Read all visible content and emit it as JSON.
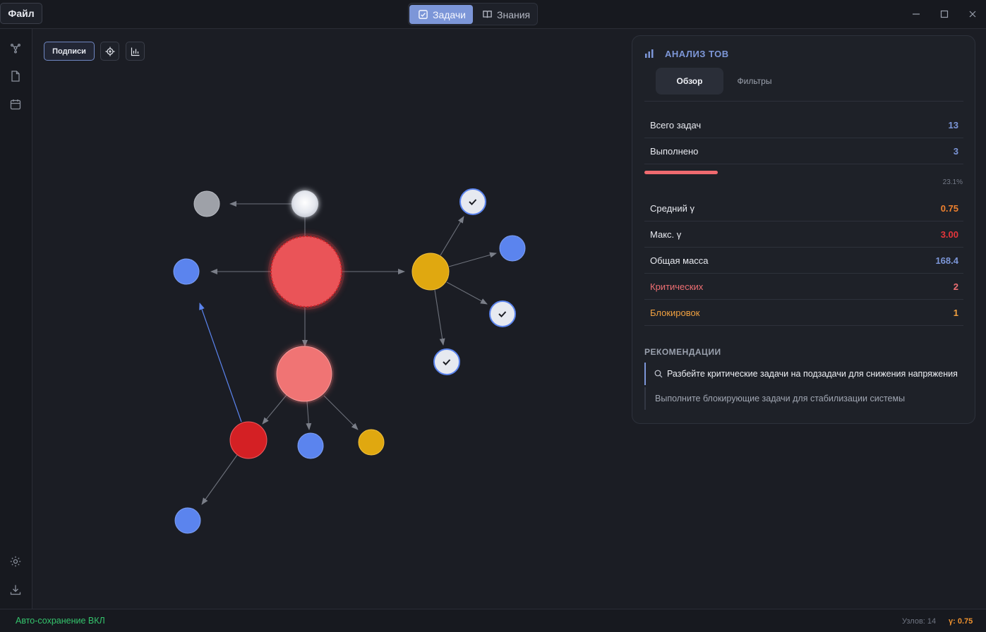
{
  "menu": {
    "file_label": "Файл"
  },
  "modes": {
    "tasks_label": "Задачи",
    "knowledge_label": "Знания"
  },
  "window_controls": [
    "minimize-icon",
    "maximize-icon",
    "close-icon"
  ],
  "sidebar": {
    "top_icons": [
      "graph-icon",
      "document-icon",
      "calendar-icon"
    ],
    "bottom_icons": [
      "gear-icon",
      "download-icon"
    ]
  },
  "toolbar": {
    "labels_button": "Подписи",
    "center_icon": "target-icon",
    "stats_icon": "bar-chart-icon"
  },
  "panel": {
    "title": "АНАЛИЗ ТОВ",
    "tabs": [
      {
        "label": "Обзор",
        "active": true
      },
      {
        "label": "Фильтры",
        "active": false
      }
    ],
    "stats": [
      {
        "label": "Всего задач",
        "value": "13",
        "label_color": "#e8eaf0",
        "value_color": "#7c96d8"
      },
      {
        "label": "Выполнено",
        "value": "3",
        "label_color": "#e8eaf0",
        "value_color": "#7c96d8"
      },
      {
        "label": "Средний γ",
        "value": "0.75",
        "label_color": "#e8eaf0",
        "value_color": "#f0812e"
      },
      {
        "label": "Макс. γ",
        "value": "3.00",
        "label_color": "#e8eaf0",
        "value_color": "#e5363b"
      },
      {
        "label": "Общая масса",
        "value": "168.4",
        "label_color": "#e8eaf0",
        "value_color": "#7c96d8"
      },
      {
        "label": "Критических",
        "value": "2",
        "label_color": "#ef6f73",
        "value_color": "#ef6f73"
      },
      {
        "label": "Блокировок",
        "value": "1",
        "label_color": "#f0a040",
        "value_color": "#f0a040"
      }
    ],
    "progress": {
      "percent": 23.1,
      "label": "23.1%"
    },
    "recommendations_title": "РЕКОМЕНДАЦИИ",
    "recommendations": [
      "Разбейте критические задачи на подзадачи для снижения напряжения",
      "Выполните блокирующие задачи для стабилизации системы"
    ]
  },
  "status": {
    "autosave": "Авто-сохранение ВКЛ",
    "nodes": "Узлов: 14",
    "gamma": "γ: 0.75"
  },
  "colors": {
    "accent": "#7c96d8",
    "critical": "#e5363b",
    "warning": "#e0a810",
    "ok": "#34c46c",
    "task_blue": "#5b84ee",
    "task_gray": "#9ea1a8"
  }
}
